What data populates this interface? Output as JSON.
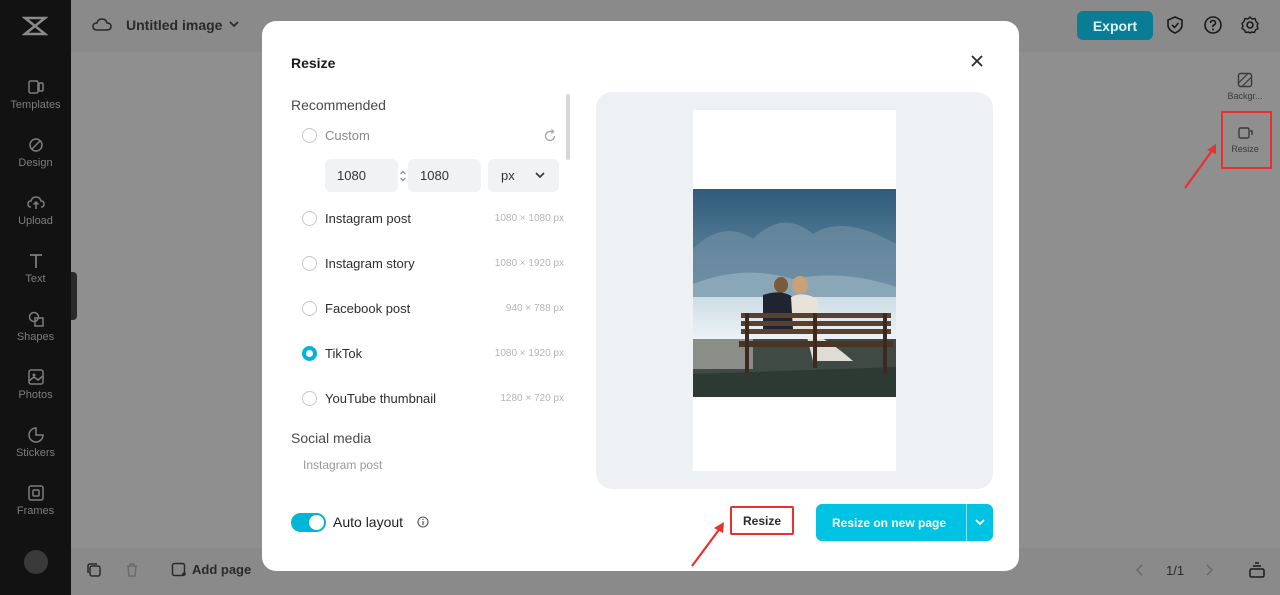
{
  "app": {
    "title": "Untitled image",
    "export_label": "Export",
    "add_page_label": "Add page",
    "page_count": "1/1"
  },
  "rail": {
    "items": [
      {
        "label": "Templates",
        "icon": "templates-icon"
      },
      {
        "label": "Design",
        "icon": "design-icon"
      },
      {
        "label": "Upload",
        "icon": "upload-icon"
      },
      {
        "label": "Text",
        "icon": "text-icon"
      },
      {
        "label": "Shapes",
        "icon": "shapes-icon"
      },
      {
        "label": "Photos",
        "icon": "photos-icon"
      },
      {
        "label": "Stickers",
        "icon": "stickers-icon"
      },
      {
        "label": "Frames",
        "icon": "frames-icon"
      }
    ]
  },
  "side_panel": {
    "items": [
      {
        "label": "Backgr...",
        "icon": "background-icon"
      },
      {
        "label": "Resize",
        "icon": "resize-icon"
      }
    ]
  },
  "modal": {
    "title": "Resize",
    "section_recommended": "Recommended",
    "section_social": "Social media",
    "custom": {
      "label": "Custom",
      "width": "1080",
      "height": "1080",
      "unit": "px"
    },
    "options": [
      {
        "label": "Instagram post",
        "dims": "1080 × 1080 px",
        "selected": false
      },
      {
        "label": "Instagram story",
        "dims": "1080 × 1920 px",
        "selected": false
      },
      {
        "label": "Facebook post",
        "dims": "940 × 788 px",
        "selected": false
      },
      {
        "label": "TikTok",
        "dims": "1080 × 1920 px",
        "selected": true
      },
      {
        "label": "YouTube thumbnail",
        "dims": "1280 × 720 px",
        "selected": false
      }
    ],
    "social_first_item": "Instagram post",
    "auto_layout_label": "Auto layout",
    "auto_layout_on": true,
    "resize_label": "Resize",
    "resize_new_page_label": "Resize on new page"
  },
  "colors": {
    "accent": "#00c3e3",
    "highlight": "#e8312f"
  }
}
